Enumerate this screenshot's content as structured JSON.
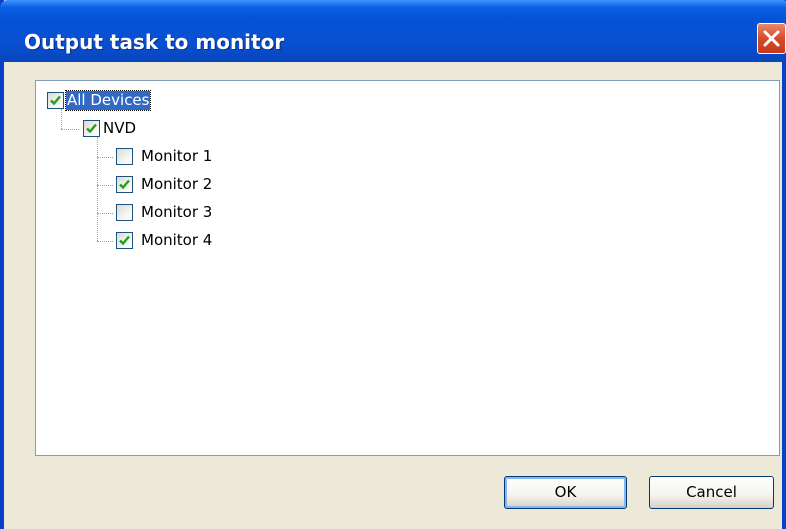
{
  "window": {
    "title": "Output task to monitor",
    "close_icon": "close-x-icon"
  },
  "tree": {
    "root": {
      "label": "All Devices",
      "checked": true,
      "focused": true
    },
    "device": {
      "label": "NVD",
      "checked": true
    },
    "monitors": [
      {
        "label": "Monitor 1",
        "checked": false
      },
      {
        "label": "Monitor 2",
        "checked": true
      },
      {
        "label": "Monitor 3",
        "checked": false
      },
      {
        "label": "Monitor 4",
        "checked": true
      }
    ]
  },
  "buttons": {
    "ok_label": "OK",
    "cancel_label": "Cancel"
  },
  "colors": {
    "titlebar": "#0553d6",
    "check": "#1fa01f",
    "selection": "#316ac5"
  }
}
